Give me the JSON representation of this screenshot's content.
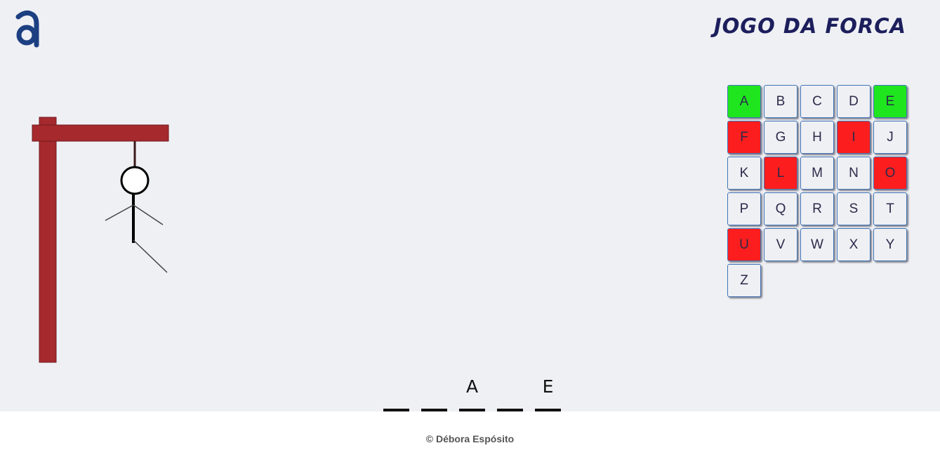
{
  "header": {
    "logo_icon": "letter-a-logo",
    "title": "JOGO DA FORCA"
  },
  "colors": {
    "correct": "#1fe51f",
    "wrong": "#fc1e1e",
    "gallows": "#a6292e",
    "title": "#1c1e5c"
  },
  "keyboard": {
    "keys": [
      {
        "label": "A",
        "state": "correct"
      },
      {
        "label": "B",
        "state": "unused"
      },
      {
        "label": "C",
        "state": "unused"
      },
      {
        "label": "D",
        "state": "unused"
      },
      {
        "label": "E",
        "state": "correct"
      },
      {
        "label": "F",
        "state": "wrong"
      },
      {
        "label": "G",
        "state": "unused"
      },
      {
        "label": "H",
        "state": "unused"
      },
      {
        "label": "I",
        "state": "wrong"
      },
      {
        "label": "J",
        "state": "unused"
      },
      {
        "label": "K",
        "state": "unused"
      },
      {
        "label": "L",
        "state": "wrong"
      },
      {
        "label": "M",
        "state": "unused"
      },
      {
        "label": "N",
        "state": "unused"
      },
      {
        "label": "O",
        "state": "wrong"
      },
      {
        "label": "P",
        "state": "unused"
      },
      {
        "label": "Q",
        "state": "unused"
      },
      {
        "label": "R",
        "state": "unused"
      },
      {
        "label": "S",
        "state": "unused"
      },
      {
        "label": "T",
        "state": "unused"
      },
      {
        "label": "U",
        "state": "wrong"
      },
      {
        "label": "V",
        "state": "unused"
      },
      {
        "label": "W",
        "state": "unused"
      },
      {
        "label": "X",
        "state": "unused"
      },
      {
        "label": "Y",
        "state": "unused"
      },
      {
        "label": "Z",
        "state": "unused"
      }
    ]
  },
  "word": {
    "slots": [
      "",
      "",
      "A",
      "",
      "E"
    ]
  },
  "hangman": {
    "parts_shown": [
      "head",
      "body",
      "left-arm",
      "right-arm",
      "right-leg"
    ]
  },
  "footer": {
    "copyright": "© Débora Espósito"
  }
}
